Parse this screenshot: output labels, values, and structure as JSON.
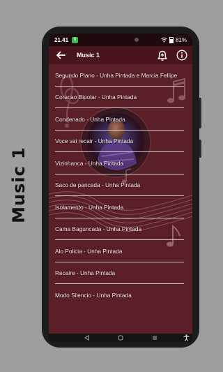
{
  "side_title": "Music 1",
  "status": {
    "time": "21.41",
    "notif_badge": "8",
    "battery": "81%"
  },
  "toolbar": {
    "title": "Music 1",
    "back_icon": "back-arrow-icon",
    "alarm_icon": "alarm-add-icon",
    "info_icon": "info-icon"
  },
  "songs": [
    "Segundo Piano - Unha Pintada e Marcia Fellipe",
    "Coracao Bipolar - Unha Pintada",
    "Condenado - Unha Pintada",
    "Voce vai recair - Unha Pintada",
    "Vizinhanca - Unha Pintada",
    "Saco de pancada - Unha Pintada",
    "Isolamento - Unha Pintada",
    "Cama Baguncada - Unha Pintada",
    "Alo Policia - Unha Pintada",
    "Recaire - Unha Pintada",
    "Modo Silencio - Unha Pintada"
  ],
  "colors": {
    "app_bar": "#4a141c",
    "list_bg": "#5a1f27",
    "divider": "#ffffff",
    "page_bg": "#9e9e9e"
  }
}
